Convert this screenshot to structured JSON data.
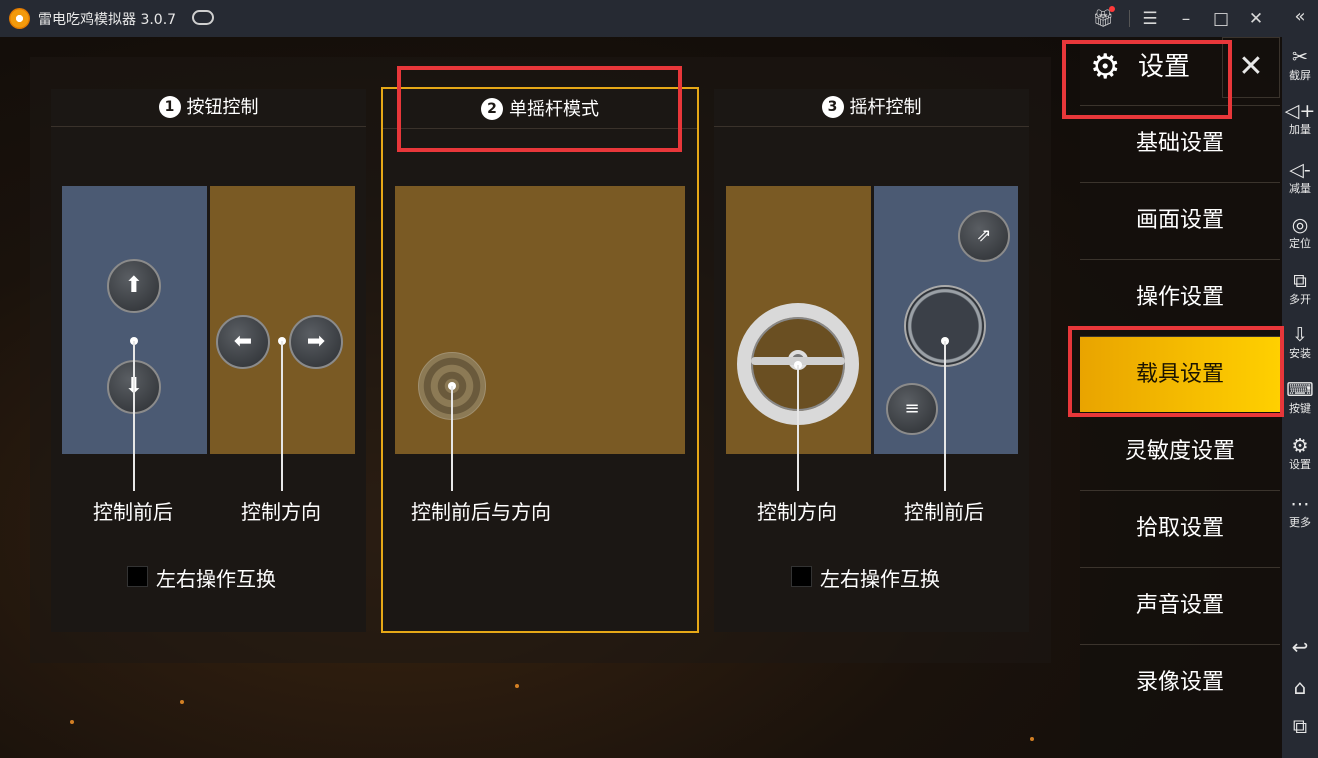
{
  "window": {
    "title": "雷电吃鸡模拟器 3.0.7",
    "controls": [
      "gift-icon",
      "menu-icon",
      "minimize-icon",
      "maximize-icon",
      "close-icon"
    ]
  },
  "toolbar": {
    "items": [
      {
        "label": "截屏",
        "icon": "scissors-icon"
      },
      {
        "label": "加量",
        "icon": "volume-up-icon"
      },
      {
        "label": "减量",
        "icon": "volume-down-icon"
      },
      {
        "label": "定位",
        "icon": "location-icon"
      },
      {
        "label": "多开",
        "icon": "multi-window-icon"
      },
      {
        "label": "安装",
        "icon": "apk-install-icon"
      },
      {
        "label": "按键",
        "icon": "keyboard-icon"
      },
      {
        "label": "设置",
        "icon": "settings-icon"
      },
      {
        "label": "更多",
        "icon": "more-icon"
      }
    ],
    "nav": [
      "back-icon",
      "home-icon",
      "recent-apps-icon"
    ]
  },
  "modes": [
    {
      "number": "1",
      "title": "按钮控制",
      "labels": [
        "控制前后",
        "控制方向"
      ],
      "swap_label": "左右操作互换",
      "swap_checked": false
    },
    {
      "number": "2",
      "title": "单摇杆模式",
      "labels": [
        "控制前后与方向"
      ],
      "selected": true
    },
    {
      "number": "3",
      "title": "摇杆控制",
      "labels": [
        "控制方向",
        "控制前后"
      ],
      "swap_label": "左右操作互换",
      "swap_checked": false
    }
  ],
  "settings_panel": {
    "title": "设置",
    "menu": [
      "基础设置",
      "画面设置",
      "操作设置",
      "载具设置",
      "灵敏度设置",
      "拾取设置",
      "声音设置",
      "录像设置"
    ],
    "active_index": 3
  },
  "colors": {
    "accent": "#ffd000",
    "highlight": "#e8373a",
    "selected_border": "#e6a817",
    "pane_blue": "#4b5a73",
    "pane_ochre": "#7a5a24"
  }
}
